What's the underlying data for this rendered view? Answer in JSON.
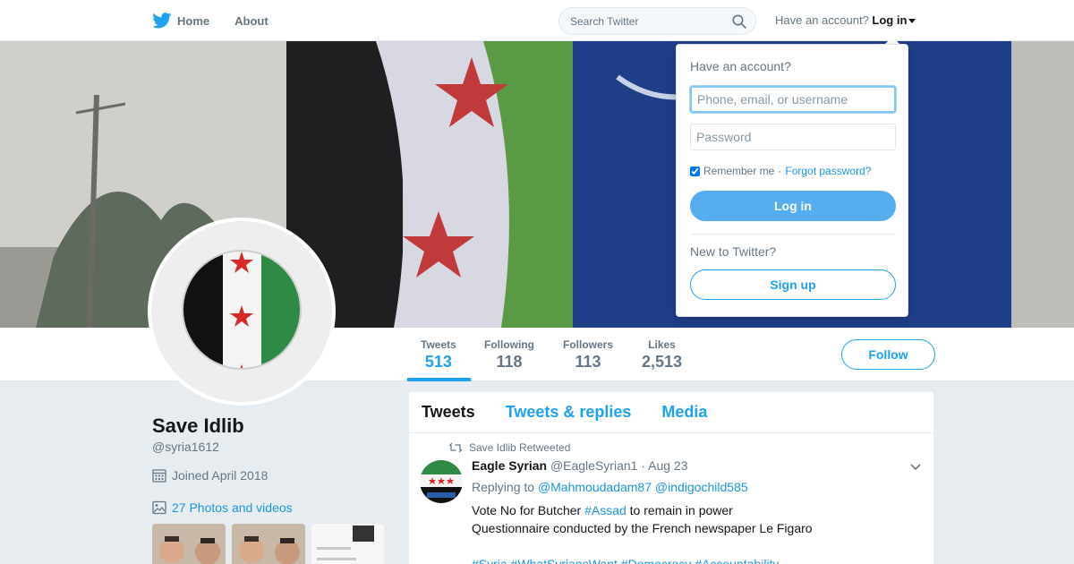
{
  "nav": {
    "home_label": "Home",
    "about_label": "About",
    "search_placeholder": "Search Twitter",
    "account_prompt": "Have an account?",
    "login_link": "Log in"
  },
  "profile": {
    "name": "Save Idlib",
    "handle": "@syria1612",
    "joined": "Joined April 2018",
    "photos_link": "27 Photos and videos",
    "follow_label": "Follow"
  },
  "stats": [
    {
      "label": "Tweets",
      "value": "513"
    },
    {
      "label": "Following",
      "value": "118"
    },
    {
      "label": "Followers",
      "value": "113"
    },
    {
      "label": "Likes",
      "value": "2,513"
    }
  ],
  "timeline": {
    "tabs": [
      "Tweets",
      "Tweets & replies",
      "Media"
    ],
    "tweet": {
      "retweet_context": "Save Idlib Retweeted",
      "fullname": "Eagle Syrian",
      "username": "@EagleSyrian1",
      "separator": "·",
      "time": "Aug 23",
      "replying_prefix": "Replying to",
      "mention_1": "@Mahmoudadam87",
      "mention_2": "@indigochild585",
      "line1_before": "Vote No for Butcher",
      "line1_hashtag": "#Assad",
      "line1_after": "to remain in power",
      "line2": "Questionnaire conducted by the French newspaper Le Figaro",
      "hashtags": [
        "#Syria",
        "#WhatSyriansWant",
        "#Democracy",
        "#Accountability"
      ]
    }
  },
  "login_dropdown": {
    "title": "Have an account?",
    "username_placeholder": "Phone, email, or username",
    "password_placeholder": "Password",
    "remember_label": "Remember me",
    "separator": "·",
    "forgot_label": "Forgot password?",
    "login_button": "Log in",
    "new_prompt": "New to Twitter?",
    "signup_button": "Sign up"
  },
  "colors": {
    "brand": "#1da1f2",
    "link": "#1b95e0",
    "login_button": "#55acee",
    "background": "#e6ecf0"
  },
  "icons": [
    "twitter-bird-icon",
    "search-icon",
    "caret-down-icon",
    "calendar-icon",
    "photo-icon",
    "retweet-icon",
    "chevron-down-icon"
  ]
}
